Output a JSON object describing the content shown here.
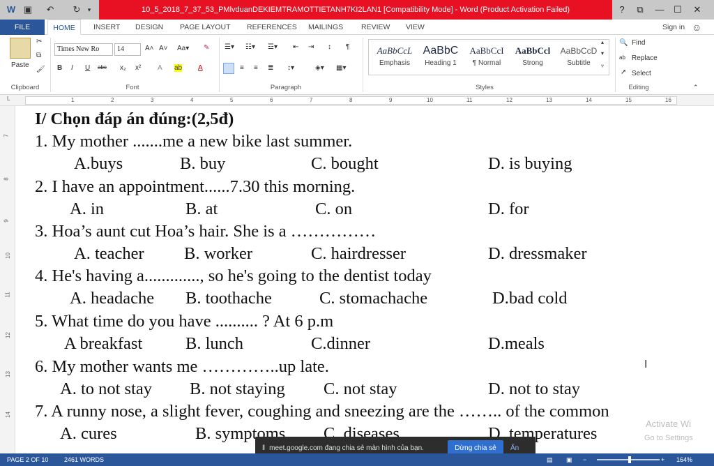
{
  "titlebar": {
    "title": "10_5_2018_7_37_53_PMlvduanDEKIEMTRAMOTTIETANH7KI2LAN1 [Compatibility Mode] - Word (Product Activation Failed)",
    "help": "?",
    "minimize": "—",
    "restore": "☐",
    "close": "✕",
    "ribbon_display": "⧉"
  },
  "tabs": [
    "FILE",
    "HOME",
    "INSERT",
    "DESIGN",
    "PAGE LAYOUT",
    "REFERENCES",
    "MAILINGS",
    "REVIEW",
    "VIEW"
  ],
  "active_tab": "HOME",
  "sign_in": "Sign in",
  "ribbon": {
    "paste_label": "Paste",
    "font_name": "Times New Ro",
    "font_size": "14",
    "font_group": "Font",
    "clipboard_group": "Clipboard",
    "paragraph_group": "Paragraph",
    "styles_group": "Styles",
    "editing_group": "Editing",
    "styles": [
      {
        "sample": "AaBbCcL",
        "name": "Emphasis"
      },
      {
        "sample": "AaBbC",
        "name": "Heading 1"
      },
      {
        "sample": "AaBbCcI",
        "name": "¶ Normal"
      },
      {
        "sample": "AaBbCcl",
        "name": "Strong"
      },
      {
        "sample": "AaBbCcD",
        "name": "Subtitle"
      }
    ],
    "find": "Find",
    "replace": "Replace",
    "select": "Select"
  },
  "ruler": [
    "1",
    "2",
    "3",
    "4",
    "5",
    "6",
    "7",
    "8",
    "9",
    "10",
    "11",
    "12",
    "13",
    "14",
    "15",
    "16"
  ],
  "vruler": [
    "7",
    "8",
    "9",
    "10",
    "11",
    "12",
    "13",
    "14"
  ],
  "document": {
    "heading": "I/ Chọn đáp án đúng:(2,5đ)",
    "questions": [
      {
        "q": "1. My mother .......me a new bike last summer.",
        "opts": [
          "A.buys",
          "B. buy",
          "C. bought",
          "D. is  buying"
        ]
      },
      {
        "q": "2. I have an appointment......7.30 this morning.",
        "opts": [
          "A. in",
          "B. at",
          "C. on",
          "D. for"
        ]
      },
      {
        "q": "3. Hoa’s aunt cut Hoa’s hair.  She is a ……………",
        "opts": [
          "A.  teacher",
          "B. worker",
          "C. hairdresser",
          "D. dressmaker"
        ]
      },
      {
        "q": "4. He's having a............., so he's going to the dentist today",
        "opts": [
          "A. headache",
          "B. toothache",
          "C. stomachache",
          "D.bad cold"
        ]
      },
      {
        "q": "5. What time do you have .......... ?  At 6 p.m",
        "opts": [
          "A breakfast",
          "B. lunch",
          "C.dinner",
          "D.meals"
        ]
      },
      {
        "q": "6. My mother wants me …………..up late.",
        "opts": [
          "A. to not stay",
          "B. not staying",
          "C. not stay",
          "D. not to stay"
        ]
      },
      {
        "q": "7. A runny nose, a slight fever, coughing and sneezing are the …….. of the common",
        "opts": [
          "A. cures",
          "B. symptoms",
          "C. diseases",
          "D. temperatures"
        ]
      }
    ]
  },
  "watermark": {
    "line1": "Activate Wi",
    "line2": "Go to Settings"
  },
  "meet_banner": {
    "message": "meet.google.com đang chia sẻ màn hình của bạn.",
    "stop": "Dừng chia sẻ",
    "hide": "Ẩn"
  },
  "status": {
    "page": "PAGE 2 OF 10",
    "words": "2461 WORDS",
    "zoom": "164%",
    "zoom_level": 0.5
  }
}
